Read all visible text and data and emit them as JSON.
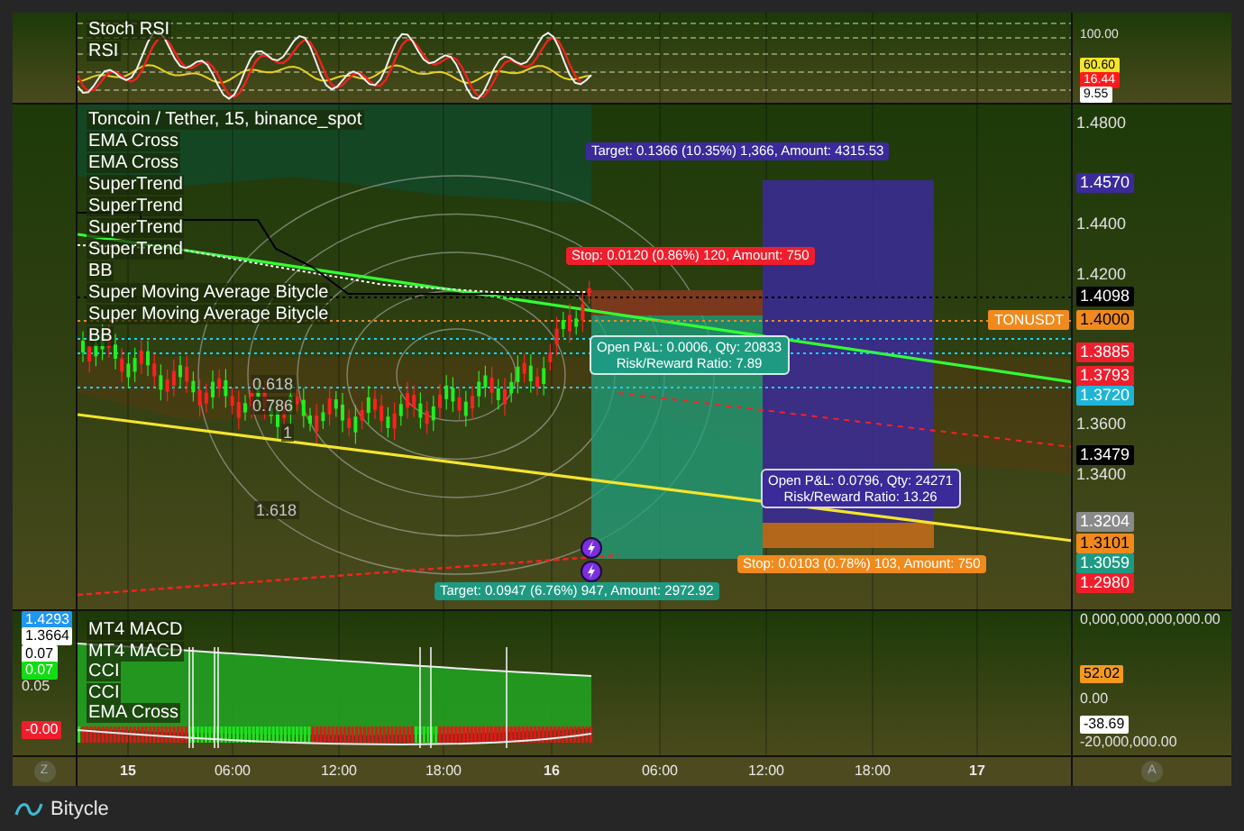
{
  "stoch_panel": {
    "legend": [
      "Stoch RSI",
      "RSI"
    ],
    "axis": [
      {
        "text": "100.00",
        "kind": "tick"
      },
      {
        "text": "60.60",
        "kind": "marker",
        "color": "#f5e52a"
      },
      {
        "text": "16.44",
        "kind": "marker",
        "color": "#ff1a1a"
      },
      {
        "text": "9.55",
        "kind": "marker",
        "color": "#ffffff"
      }
    ]
  },
  "main_panel": {
    "legend": [
      "Toncoin / Tether, 15, binance_spot",
      "EMA Cross",
      "EMA Cross",
      "SuperTrend",
      "SuperTrend",
      "SuperTrend",
      "SuperTrend",
      "BB",
      "Super Moving Average Bitycle",
      "Super Moving Average Bitycle",
      "BB"
    ],
    "fib_levels": [
      "0.618",
      "0.786",
      "1",
      "1.618"
    ],
    "order_labels": [
      {
        "text": "Target: 0.1366 (10.35%) 1,366, Amount: 4315.53",
        "color": "#3b2a9a"
      },
      {
        "text": "Stop: 0.0120 (0.86%) 120, Amount: 750",
        "color": "#f01e2c"
      },
      {
        "text": "Stop: 0.0103 (0.78%) 103, Amount: 750",
        "color": "#f08a1c"
      },
      {
        "text": "Target: 0.0947 (6.76%) 947, Amount: 2972.92",
        "color": "#1f9a82"
      }
    ],
    "pnl_boxes": [
      {
        "lines": [
          "Open P&L: 0.0006, Qty: 20833",
          "Risk/Reward Ratio: 7.89"
        ],
        "color": "#1f9a82"
      },
      {
        "lines": [
          "Open P&L: 0.0796, Qty: 24271",
          "Risk/Reward Ratio: 13.26"
        ],
        "color": "#3b2a9a"
      }
    ],
    "symbol_tag": "TONUSDT",
    "axis": [
      {
        "text": "1.4800",
        "kind": "tick"
      },
      {
        "text": "1.4570",
        "kind": "marker",
        "color": "#3b2a9a"
      },
      {
        "text": "1.4400",
        "kind": "tick"
      },
      {
        "text": "1.4200",
        "kind": "tick"
      },
      {
        "text": "1.4098",
        "kind": "marker",
        "color": "#000000"
      },
      {
        "text": "1.4000",
        "kind": "marker",
        "color": "#f08a1c"
      },
      {
        "text": "1.3885",
        "kind": "marker",
        "color": "#f01e2c"
      },
      {
        "text": "1.3793",
        "kind": "marker",
        "color": "#f01e2c"
      },
      {
        "text": "1.3720",
        "kind": "marker",
        "color": "#1fb5d8"
      },
      {
        "text": "1.3600",
        "kind": "tick"
      },
      {
        "text": "1.3479",
        "kind": "marker",
        "color": "#000000"
      },
      {
        "text": "1.3400",
        "kind": "tick"
      },
      {
        "text": "1.3204",
        "kind": "marker",
        "color": "#8a8a8a"
      },
      {
        "text": "1.3101",
        "kind": "marker",
        "color": "#f08a1c"
      },
      {
        "text": "1.3059",
        "kind": "marker",
        "color": "#1f9a82"
      },
      {
        "text": "1.2980",
        "kind": "marker",
        "color": "#f01e2c"
      }
    ]
  },
  "bottom_panel": {
    "legend": [
      "MT4 MACD",
      "MT4 MACD",
      "CCI",
      "CCI",
      "EMA Cross"
    ],
    "left_axis": [
      {
        "text": "1.4293",
        "kind": "marker",
        "color": "#2196f3"
      },
      {
        "text": "1.3664",
        "kind": "marker",
        "color": "#ffffff"
      },
      {
        "text": "0.07",
        "kind": "marker",
        "color": "#ffffff"
      },
      {
        "text": "0.07",
        "kind": "marker",
        "color": "#11dd11"
      },
      {
        "text": "0.05",
        "kind": "tick"
      },
      {
        "text": "-0.00",
        "kind": "marker",
        "color": "#f01e2c"
      }
    ],
    "right_axis": [
      {
        "text": "0,000,000,000,000.00",
        "kind": "tick"
      },
      {
        "text": "52.02",
        "kind": "marker",
        "color": "#f59a1c"
      },
      {
        "text": "0.00",
        "kind": "tick"
      },
      {
        "text": "-38.69",
        "kind": "marker",
        "color": "#ffffff"
      },
      {
        "text": "-20,000,000.00",
        "kind": "tick"
      }
    ]
  },
  "time_axis": {
    "left_button": "Z",
    "right_button": "A",
    "labels": [
      {
        "text": "15",
        "kind": "day"
      },
      {
        "text": "06:00",
        "kind": "time"
      },
      {
        "text": "12:00",
        "kind": "time"
      },
      {
        "text": "18:00",
        "kind": "time"
      },
      {
        "text": "16",
        "kind": "day"
      },
      {
        "text": "06:00",
        "kind": "time"
      },
      {
        "text": "12:00",
        "kind": "time"
      },
      {
        "text": "18:00",
        "kind": "time"
      },
      {
        "text": "17",
        "kind": "day"
      }
    ]
  },
  "footer": {
    "brand": "Bitycle"
  }
}
